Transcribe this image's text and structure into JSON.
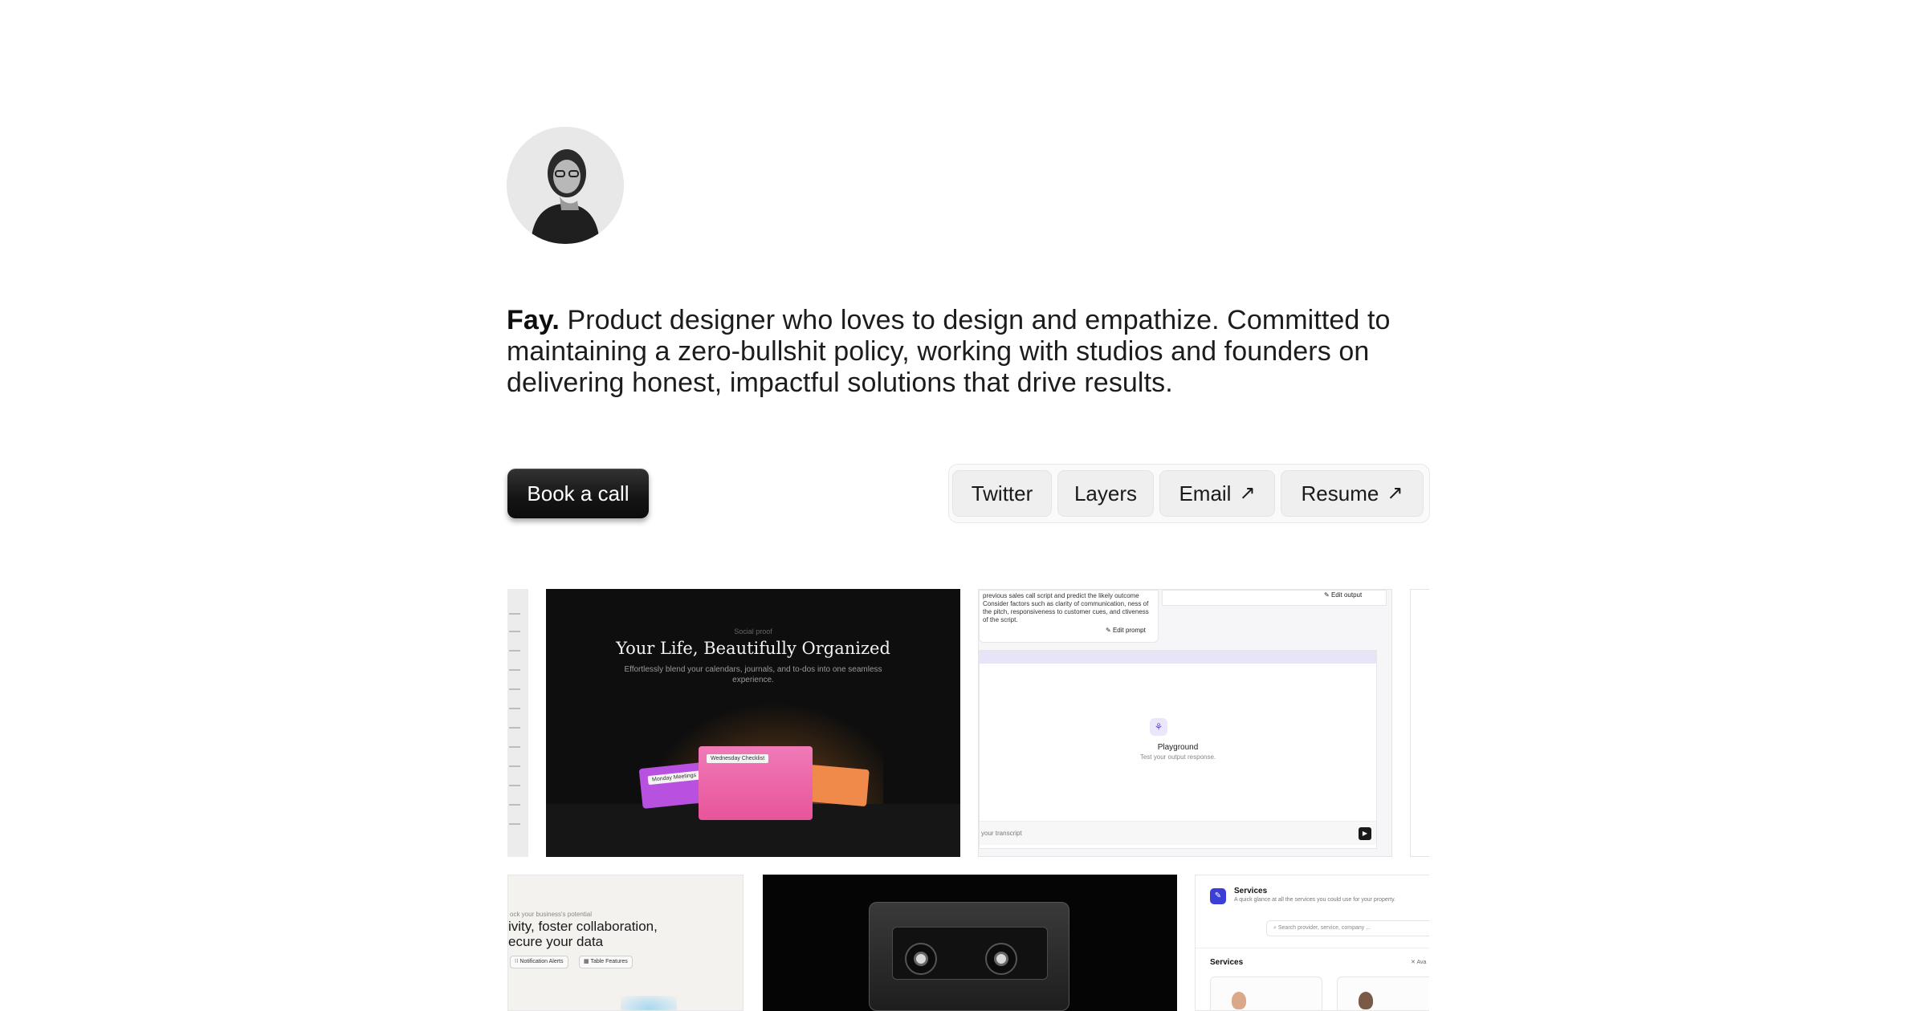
{
  "profile": {
    "name": "Fay.",
    "bio": "Product designer who loves to design and empathize. Committed to maintaining a zero-bullshit policy, working with studios and founders on delivering honest, impactful solutions that drive results."
  },
  "actions": {
    "book_label": "Book a call",
    "links": [
      {
        "label": "Twitter",
        "external": false
      },
      {
        "label": "Layers",
        "external": false
      },
      {
        "label": "Email",
        "external": true
      },
      {
        "label": "Resume",
        "external": true
      }
    ],
    "external_glyph": "↗"
  },
  "gallery": {
    "organized": {
      "eyebrow": "Social proof",
      "title": "Your Life, Beautifully Organized",
      "subtitle": "Effortlessly blend your calendars, journals, and to-dos into one seamless experience.",
      "cards": [
        "Monday Meetings",
        "Wednesday Checklist"
      ]
    },
    "playground": {
      "prompt_text": "previous sales call script and predict the likely outcome Consider factors such as clarity of communication, ness of the pitch, responsiveness to customer cues, and ctiveness of the script.",
      "edit_prompt": "Edit prompt",
      "edit_output": "Edit output",
      "title": "Playground",
      "subtitle": "Test your output response.",
      "input_placeholder": "your transcript"
    },
    "business": {
      "eyebrow": "ock your business's potential",
      "headline": "ivity, foster collaboration, ecure your data",
      "chips": [
        "Notification Alerts",
        "Table Features"
      ]
    },
    "services": {
      "title": "Services",
      "subtitle": "A quick glance at all the services you could use for your property.",
      "search_placeholder": "Search provider, service, company ...",
      "section": "Services",
      "filter": "Ava"
    }
  },
  "colors": {
    "accent_dark": "#141414",
    "pink": "#e8549a",
    "purple": "#b850e0",
    "orange": "#f08a4a",
    "services_blue": "#3b3fd8"
  }
}
